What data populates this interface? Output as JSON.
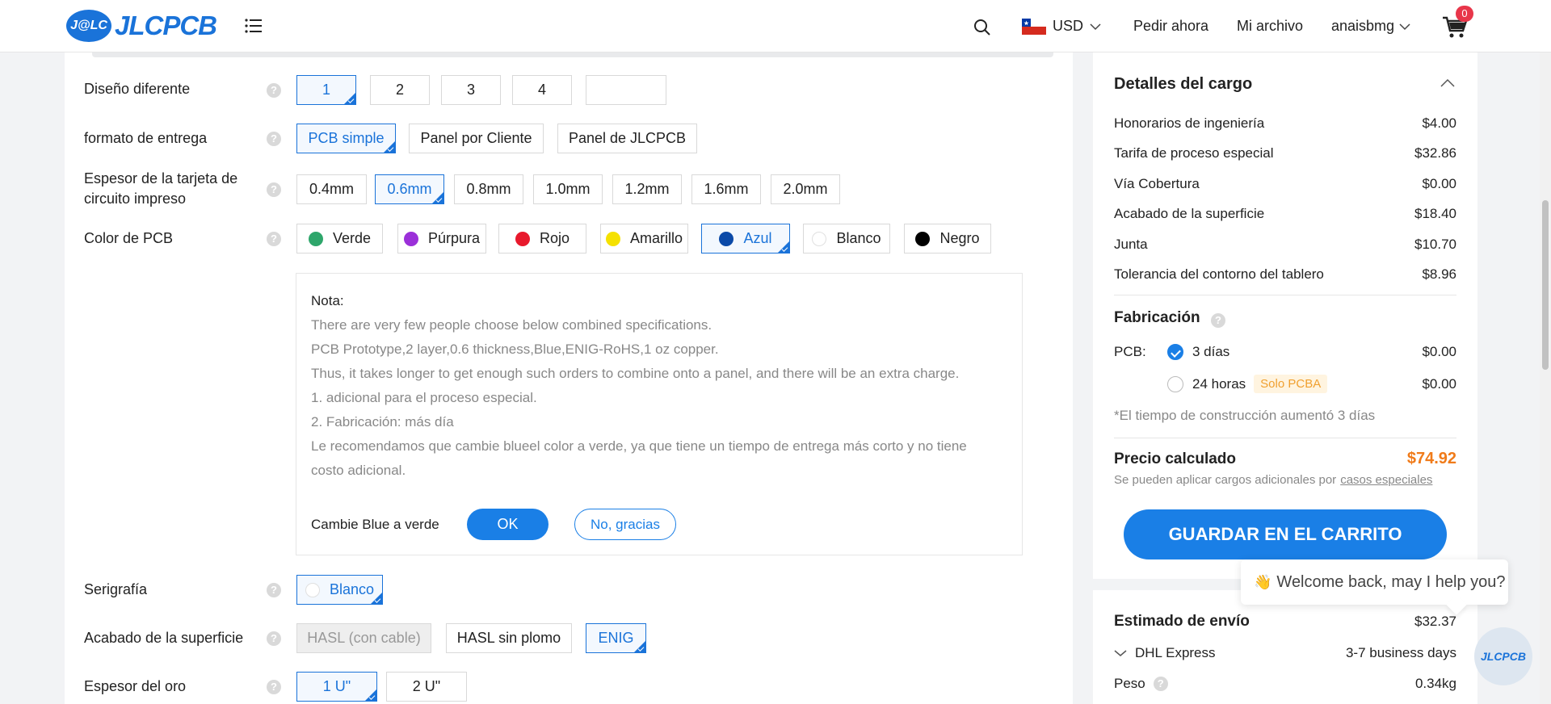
{
  "header": {
    "logo_badge": "J@LC",
    "logo_text": "JLCPCB",
    "currency": "USD",
    "order_now": "Pedir ahora",
    "my_files": "Mi archivo",
    "user": "anaisbmg",
    "cart_count": "0"
  },
  "form": {
    "different_design": {
      "label": "Diseño diferente",
      "options": [
        "1",
        "2",
        "3",
        "4",
        ""
      ],
      "selected": "1"
    },
    "delivery_format": {
      "label": "formato de entrega",
      "options": [
        "PCB simple",
        "Panel por Cliente",
        "Panel de JLCPCB"
      ],
      "selected": "PCB simple"
    },
    "thickness": {
      "label": "Espesor de la tarjeta de circuito impreso",
      "options": [
        "0.4mm",
        "0.6mm",
        "0.8mm",
        "1.0mm",
        "1.2mm",
        "1.6mm",
        "2.0mm"
      ],
      "selected": "0.6mm"
    },
    "pcb_color": {
      "label": "Color de PCB",
      "options": [
        {
          "name": "Verde",
          "color": "#2ea66b"
        },
        {
          "name": "Púrpura",
          "color": "#9b30d9"
        },
        {
          "name": "Rojo",
          "color": "#e8192c"
        },
        {
          "name": "Amarillo",
          "color": "#f5e100"
        },
        {
          "name": "Azul",
          "color": "#0b4aa8"
        },
        {
          "name": "Blanco",
          "color": "#ffffff"
        },
        {
          "name": "Negro",
          "color": "#000000"
        }
      ],
      "selected": "Azul"
    },
    "note": {
      "title": "Nota:",
      "lines": [
        "There are very few people choose below combined specifications.",
        "PCB Prototype,2 layer,0.6 thickness,Blue,ENIG-RoHS,1 oz copper.",
        "Thus, it takes longer to get enough such orders to combine onto a panel, and there will be an extra charge.",
        "1. adicional para el proceso especial.",
        "2. Fabricación: más día",
        "Le recomendamos que cambie blueel color a verde, ya que tiene un tiempo de entrega más corto y no tiene",
        "costo adicional."
      ],
      "change_label": "Cambie Blue a verde",
      "ok": "OK",
      "no_thanks": "No, gracias"
    },
    "silkscreen": {
      "label": "Serigrafía",
      "options": [
        "Blanco"
      ],
      "selected": "Blanco"
    },
    "surface_finish": {
      "label": "Acabado de la superficie",
      "options": [
        "HASL (con cable)",
        "HASL sin plomo",
        "ENIG"
      ],
      "selected": "ENIG",
      "disabled": "HASL (con cable)"
    },
    "gold_thickness": {
      "label": "Espesor del oro",
      "options": [
        "1 U\"",
        "2 U\""
      ],
      "selected": "1 U\""
    }
  },
  "charges": {
    "title": "Detalles del cargo",
    "items": [
      {
        "label": "Honorarios de ingeniería",
        "value": "$4.00"
      },
      {
        "label": "Tarifa de proceso especial",
        "value": "$32.86"
      },
      {
        "label": "Vía Cobertura",
        "value": "$0.00"
      },
      {
        "label": "Acabado de la superficie",
        "value": "$18.40"
      },
      {
        "label": "Junta",
        "value": "$10.70"
      },
      {
        "label": "Tolerancia del contorno del tablero",
        "value": "$8.96"
      }
    ],
    "fabrication_title": "Fabricación",
    "pcb_label": "PCB:",
    "build_options": [
      {
        "label": "3 días",
        "value": "$0.00",
        "selected": true
      },
      {
        "label": "24 horas",
        "value": "$0.00",
        "badge": "Solo PCBA"
      }
    ],
    "build_note": "*El tiempo de construcción aumentó 3 días",
    "calculated_price_label": "Precio calculado",
    "calculated_price": "$74.92",
    "extra_note": "Se pueden aplicar cargos adicionales por",
    "extra_link": "casos especiales",
    "save_button": "GUARDAR EN EL CARRITO"
  },
  "shipping": {
    "title": "Estimado de envío",
    "price": "$32.37",
    "carrier": "DHL Express",
    "eta": "3-7 business days",
    "weight_label": "Peso",
    "weight": "0.34kg"
  },
  "chat": {
    "emoji": "👋",
    "message": "Welcome back, may I help you?",
    "fab_label": "JLCPCB"
  },
  "colors": {
    "accent": "#1a7fe6",
    "price": "#f07b1a"
  }
}
